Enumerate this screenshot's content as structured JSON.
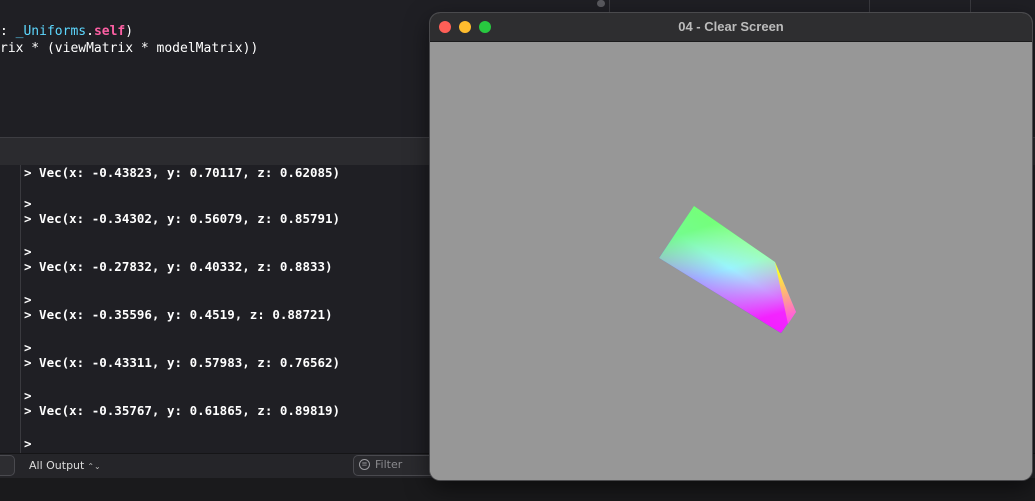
{
  "editor": {
    "lines": [
      {
        "prefix": ": ",
        "type": "_Uniforms",
        "dot": ".",
        "keyword": "self",
        "suffix": ")"
      },
      {
        "text": "rix * (viewMatrix * modelMatrix))"
      }
    ]
  },
  "console": {
    "prompt": ">",
    "lines": [
      "> Vec(x: -0.43823, y: 0.70117, z: 0.62085)",
      "> Vec(x: -0.34302, y: 0.56079, z: 0.85791)",
      "> Vec(x: -0.27832, y: 0.40332, z: 0.8833)",
      "> Vec(x: -0.35596, y: 0.4519, z: 0.88721)",
      "> Vec(x: -0.43311, y: 0.57983, z: 0.76562)",
      "> Vec(x: -0.35767, y: 0.61865, z: 0.89819)"
    ]
  },
  "footer": {
    "output_label": "All Output",
    "output_chevron": "⌃⌄",
    "filter_placeholder": "Filter",
    "filter_icon": "filter-circle-icon"
  },
  "window": {
    "title": "04 - Clear Screen",
    "clear_color": "#979797",
    "traffic_lights": {
      "close": "#ff5f57",
      "minimize": "#febc2e",
      "maximize": "#28c840"
    }
  },
  "colors": {
    "editor_bg": "#1f1f24",
    "type_color": "#5dd8ff",
    "keyword_color": "#fc5fa3"
  }
}
